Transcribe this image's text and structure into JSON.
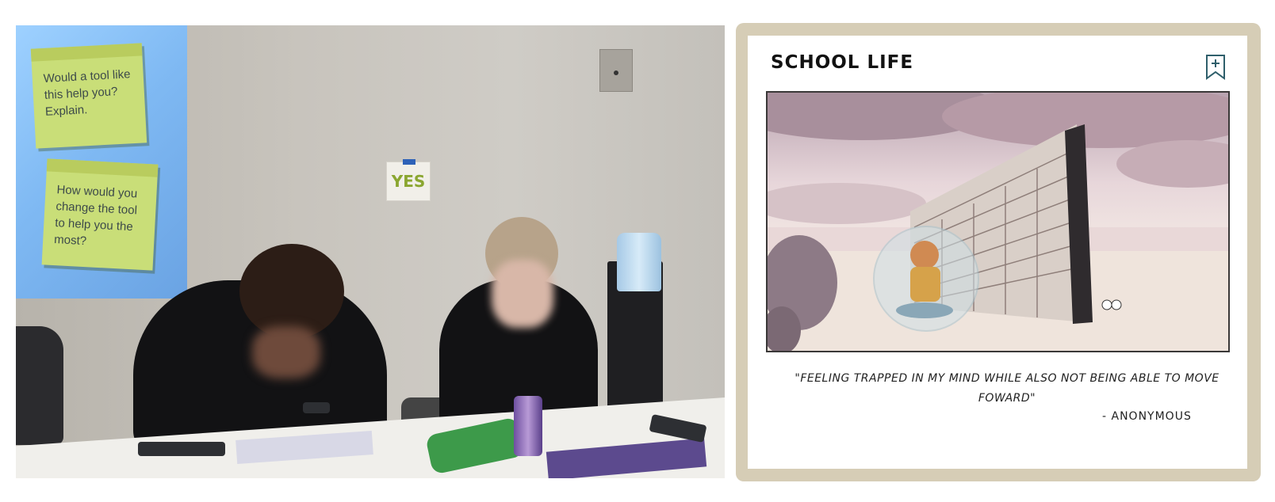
{
  "photo": {
    "sticky_notes": [
      {
        "text": "Would a tool like this help you? Explain."
      },
      {
        "text": "How would you change the tool to help you the most?"
      }
    ],
    "wall_sign": "YES"
  },
  "card": {
    "title": "SCHOOL LIFE",
    "bookmark_icon": "bookmark-plus-icon",
    "quote": "\"Feeling trapped in my mind while also not being able to move foward\"",
    "author": "- ANONYMOUS",
    "colors": {
      "frame": "#d6cdb6",
      "bookmark": "#2f5f6b"
    }
  }
}
